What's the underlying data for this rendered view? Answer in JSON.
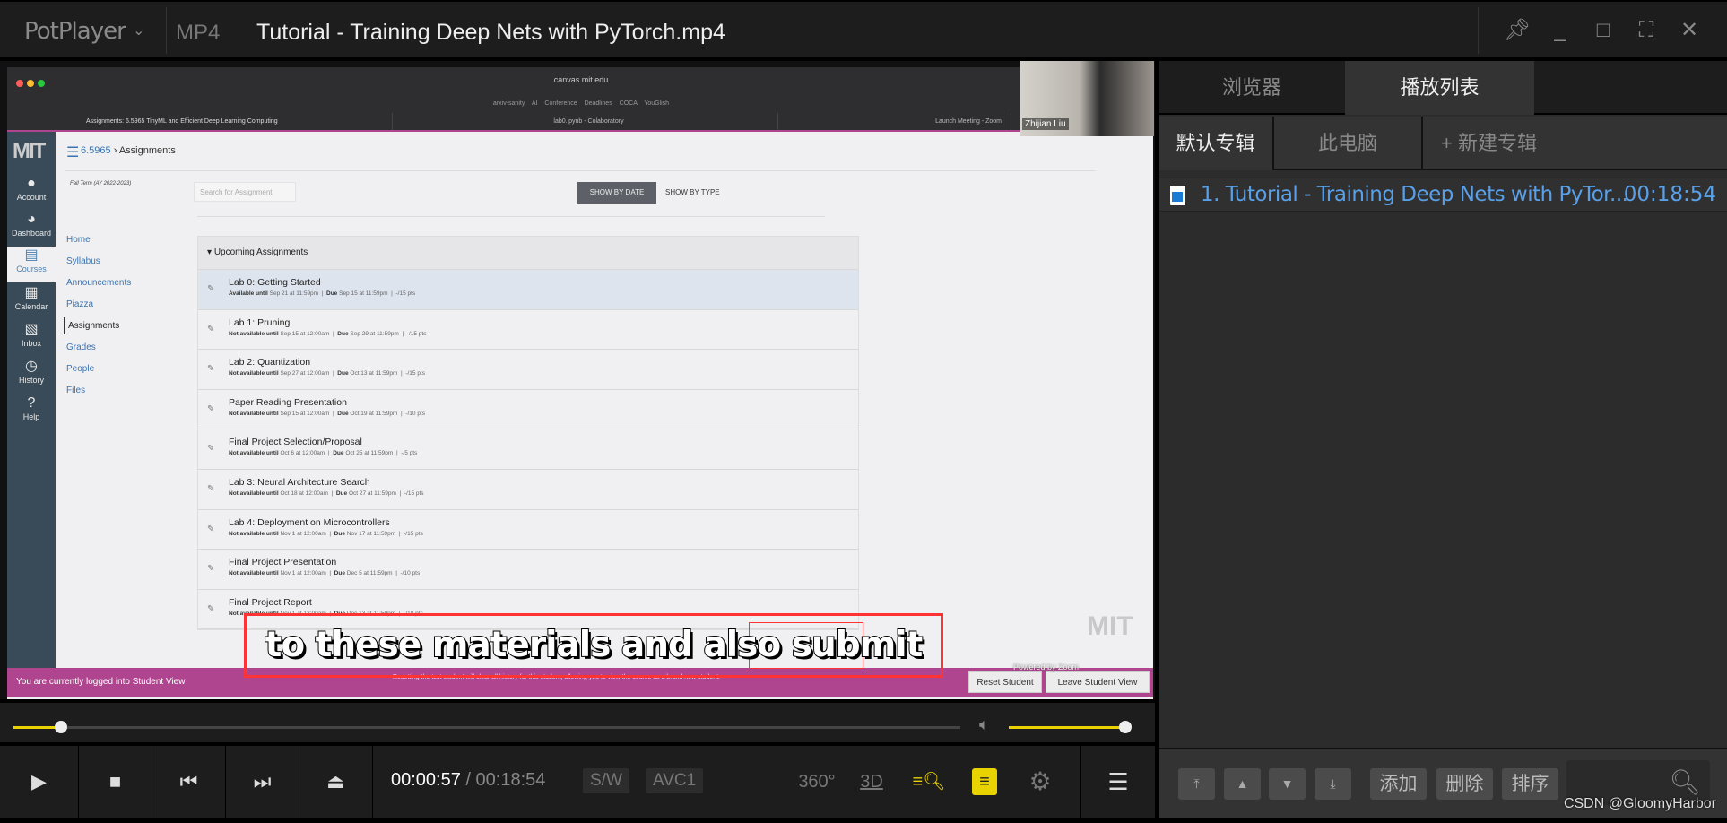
{
  "titlebar": {
    "app": "PotPlayer",
    "format": "MP4",
    "title": "Tutorial - Training Deep Nets with PyTorch.mp4"
  },
  "browser": {
    "url": "canvas.mit.edu",
    "bookmarks": "arxiv-sanity  AI Conference Deadlines  COCA  YouGlish",
    "tabs": [
      "Assignments: 6.5965 TinyML and Efficient Deep Learning Computing",
      "lab0.ipynb - Colaboratory",
      "Launch Meeting - Zoom"
    ]
  },
  "webcam": {
    "name": "Zhijian Liu"
  },
  "canvas": {
    "global_nav": [
      {
        "label": "Account",
        "icon": "account-icon"
      },
      {
        "label": "Dashboard",
        "icon": "dashboard-icon"
      },
      {
        "label": "Courses",
        "icon": "courses-icon"
      },
      {
        "label": "Calendar",
        "icon": "calendar-icon"
      },
      {
        "label": "Inbox",
        "icon": "inbox-icon"
      },
      {
        "label": "History",
        "icon": "history-icon"
      },
      {
        "label": "Help",
        "icon": "help-icon"
      }
    ],
    "breadcrumb": {
      "course": "6.5965",
      "sep": "›",
      "page": "Assignments"
    },
    "term": "Fall Term (AY 2022-2023)",
    "course_nav": [
      "Home",
      "Syllabus",
      "Announcements",
      "Piazza",
      "Assignments",
      "Grades",
      "People",
      "Files"
    ],
    "search_placeholder": "Search for Assignment",
    "show_by_date": "SHOW BY DATE",
    "show_by_type": "SHOW BY TYPE",
    "group_title": "Upcoming Assignments",
    "assignments": [
      {
        "title": "Lab 0: Getting Started",
        "avail_label": "Available until",
        "avail": "Sep 21 at 11:59pm",
        "due": "Sep 15 at 11:59pm",
        "pts": "-/15 pts"
      },
      {
        "title": "Lab 1: Pruning",
        "avail_label": "Not available until",
        "avail": "Sep 15 at 12:00am",
        "due": "Sep 29 at 11:59pm",
        "pts": "-/15 pts"
      },
      {
        "title": "Lab 2: Quantization",
        "avail_label": "Not available until",
        "avail": "Sep 27 at 12:00am",
        "due": "Oct 13 at 11:59pm",
        "pts": "-/15 pts"
      },
      {
        "title": "Paper Reading Presentation",
        "avail_label": "Not available until",
        "avail": "Sep 15 at 12:00am",
        "due": "Oct 19 at 11:59pm",
        "pts": "-/10 pts"
      },
      {
        "title": "Final Project Selection/Proposal",
        "avail_label": "Not available until",
        "avail": "Oct 6 at 12:00am",
        "due": "Oct 25 at 11:59pm",
        "pts": "-/5 pts"
      },
      {
        "title": "Lab 3: Neural Architecture Search",
        "avail_label": "Not available until",
        "avail": "Oct 18 at 12:00am",
        "due": "Oct 27 at 11:59pm",
        "pts": "-/15 pts"
      },
      {
        "title": "Lab 4: Deployment on Microcontrollers",
        "avail_label": "Not available until",
        "avail": "Nov 1 at 12:00am",
        "due": "Nov 17 at 11:59pm",
        "pts": "-/15 pts"
      },
      {
        "title": "Final Project Presentation",
        "avail_label": "Not available until",
        "avail": "Nov 1 at 12:00am",
        "due": "Dec 5 at 11:59pm",
        "pts": "-/10 pts"
      },
      {
        "title": "Final Project Report",
        "avail_label": "Not available until",
        "avail": "Nov 1 at 12:00am",
        "due": "Dec 13 at 11:59pm",
        "pts": "-/10 pts"
      }
    ],
    "due_label": "Due",
    "student_view": {
      "message": "You are currently logged into Student View",
      "desc": "Resetting the test student will clear all history for this student, allowing you to view the course as a brand new student.",
      "reset": "Reset Student",
      "leave": "Leave Student View"
    },
    "powered_by": "Powered by Zoom"
  },
  "subtitle": "to these materials and also submit",
  "player": {
    "current_time": "00:00:57",
    "total_time": "00:18:54",
    "progress_fraction": 0.05,
    "volume_fraction": 1.0,
    "decoder": "S/W",
    "codec": "AVC1",
    "accent": "#e8d200",
    "icons": [
      "play-icon",
      "stop-icon",
      "previous-icon",
      "next-icon",
      "eject-icon",
      "360-icon",
      "3d-icon",
      "subtitle-search-icon",
      "subtitle-icon",
      "settings-icon",
      "menu-icon"
    ]
  },
  "playlist_panel": {
    "tabs": [
      "浏览器",
      "播放列表"
    ],
    "subtabs": [
      "默认专辑",
      "此电脑",
      "+ 新建专辑"
    ],
    "items": [
      {
        "title": "1. Tutorial - Training Deep Nets with PyTor...",
        "duration": "00:18:54"
      }
    ],
    "buttons": [
      "添加",
      "删除",
      "排序"
    ],
    "watermark": "CSDN @GloomyHarbor"
  }
}
